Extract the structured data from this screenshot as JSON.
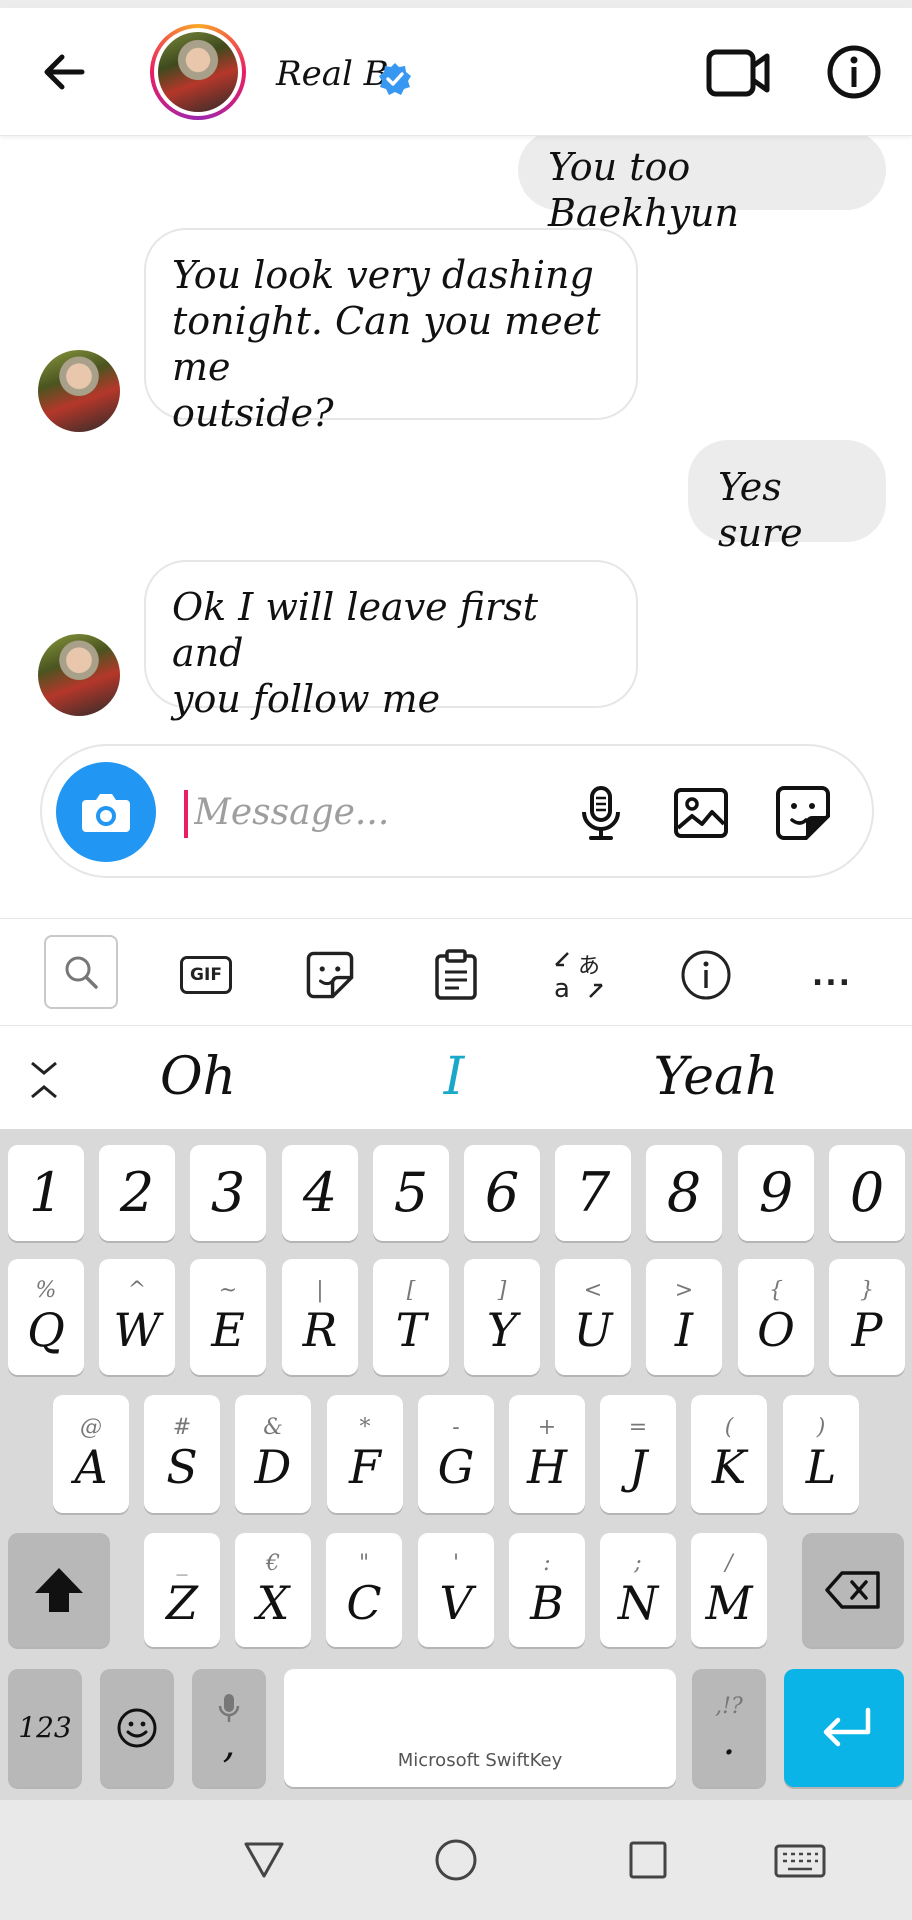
{
  "header": {
    "name": "Real B"
  },
  "messages": [
    {
      "side": "out",
      "text": "You too Baekhyun"
    },
    {
      "side": "in",
      "lines": [
        "You look very dashing",
        "tonight. Can you meet me",
        "outside?"
      ]
    },
    {
      "side": "out",
      "text": "Yes sure"
    },
    {
      "side": "in",
      "lines": [
        "Ok I will leave first and",
        "you follow me"
      ]
    }
  ],
  "composer": {
    "placeholder": "Message..."
  },
  "keyboard_toolbar": {
    "gif_label": "GIF",
    "translate_label": "あ",
    "more_label": "..."
  },
  "suggestions": [
    "Oh",
    "I",
    "Yeah"
  ],
  "keyboard": {
    "number_row": [
      "1",
      "2",
      "3",
      "4",
      "5",
      "6",
      "7",
      "8",
      "9",
      "0"
    ],
    "row1": [
      {
        "main": "Q",
        "sub": "%"
      },
      {
        "main": "W",
        "sub": "^"
      },
      {
        "main": "E",
        "sub": "~"
      },
      {
        "main": "R",
        "sub": "|"
      },
      {
        "main": "T",
        "sub": "["
      },
      {
        "main": "Y",
        "sub": "]"
      },
      {
        "main": "U",
        "sub": "<"
      },
      {
        "main": "I",
        "sub": ">"
      },
      {
        "main": "O",
        "sub": "{"
      },
      {
        "main": "P",
        "sub": "}"
      }
    ],
    "row2": [
      {
        "main": "A",
        "sub": "@"
      },
      {
        "main": "S",
        "sub": "#"
      },
      {
        "main": "D",
        "sub": "&"
      },
      {
        "main": "F",
        "sub": "*"
      },
      {
        "main": "G",
        "sub": "-"
      },
      {
        "main": "H",
        "sub": "+"
      },
      {
        "main": "J",
        "sub": "="
      },
      {
        "main": "K",
        "sub": "("
      },
      {
        "main": "L",
        "sub": ")"
      }
    ],
    "row3": [
      {
        "main": "Z",
        "sub": "_"
      },
      {
        "main": "X",
        "sub": "€"
      },
      {
        "main": "C",
        "sub": "\""
      },
      {
        "main": "V",
        "sub": "'"
      },
      {
        "main": "B",
        "sub": ":"
      },
      {
        "main": "N",
        "sub": ";"
      },
      {
        "main": "M",
        "sub": "/"
      }
    ],
    "numbers_key": "123",
    "comma_key": ",",
    "space_label": "Microsoft SwiftKey",
    "period_key": ".",
    "period_sub": ",!?"
  },
  "colors": {
    "accent_blue": "#2196f3",
    "enter_key": "#0ab4e6",
    "suggestion_highlight": "#1aa8c9",
    "cursor": "#e91e63"
  }
}
